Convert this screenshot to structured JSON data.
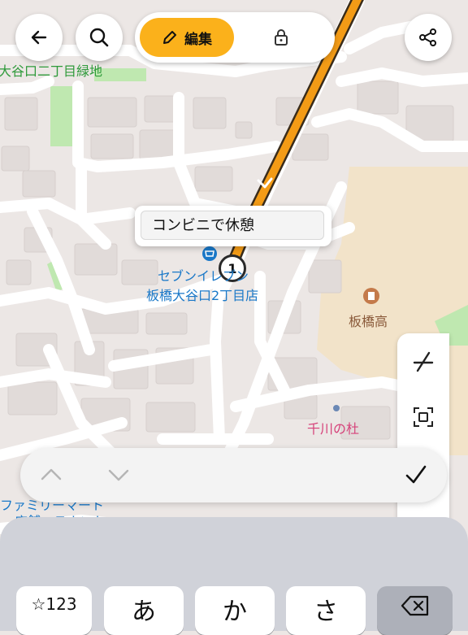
{
  "map": {
    "labels": {
      "park": "大谷口二丁目緑地",
      "store_line1": "セブンイレブン",
      "store_line2": "板橋大谷口2丁目店",
      "school": "板橋高",
      "place": "千川の杜",
      "bottom_store_line1": "ファミリーマート",
      "bottom_store_line2": "店舗・テナント"
    },
    "waypoint_number": "1",
    "colors": {
      "route": "#f39b16",
      "route_outline": "#3a2c1a",
      "label_blue": "#1a78c8",
      "label_brown": "#8a5a3a",
      "label_pink": "#d6427a",
      "label_green": "#2e9a3a",
      "park": "#bfe8b0",
      "school_area": "#f2e3c9"
    }
  },
  "header": {
    "back_icon": "arrow-left-icon",
    "search_icon": "search-icon",
    "edit_label": "編集",
    "edit_icon": "pencil-icon",
    "lock_icon": "lock-icon",
    "share_icon": "share-icon",
    "edit_color": "#fbb11b"
  },
  "popup": {
    "value": "コンビニで休憩"
  },
  "side_panel": {
    "icons": [
      "route-off-icon",
      "fit-frame-icon"
    ]
  },
  "accessory_bar": {
    "icons": [
      "chevron-up-icon",
      "chevron-down-icon",
      "checkmark-icon"
    ]
  },
  "keyboard": {
    "keys": [
      "☆123",
      "あ",
      "か",
      "さ"
    ],
    "delete_icon": "delete-icon"
  }
}
